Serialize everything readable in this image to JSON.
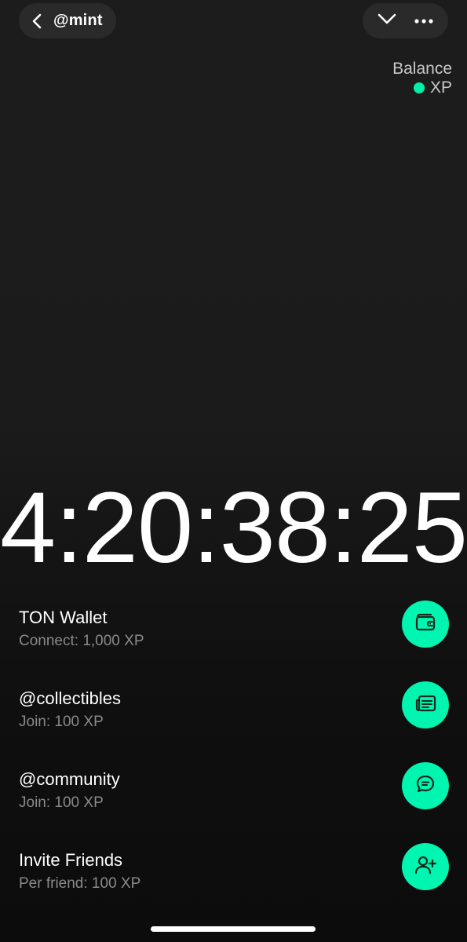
{
  "header": {
    "title": "@mint",
    "back_icon": "chevron-left-icon",
    "collapse_icon": "chevron-down-icon",
    "more_icon": "more-horizontal-icon"
  },
  "balance": {
    "label": "Balance",
    "unit": "XP",
    "dot_color": "#00f0a8"
  },
  "timer": {
    "value": "4:20:38:25"
  },
  "tasks": [
    {
      "name": "TON Wallet",
      "reward": "Connect: 1,000 XP",
      "icon": "wallet-icon"
    },
    {
      "name": "@collectibles",
      "reward": "Join: 100 XP",
      "icon": "newspaper-icon"
    },
    {
      "name": "@community",
      "reward": "Join: 100 XP",
      "icon": "chat-bubble-icon"
    },
    {
      "name": "Invite Friends",
      "reward": "Per friend: 100 XP",
      "icon": "add-user-icon"
    }
  ],
  "colors": {
    "accent": "#00f5b0",
    "background": "#1b1b1b",
    "pill": "#2a2a2a"
  }
}
